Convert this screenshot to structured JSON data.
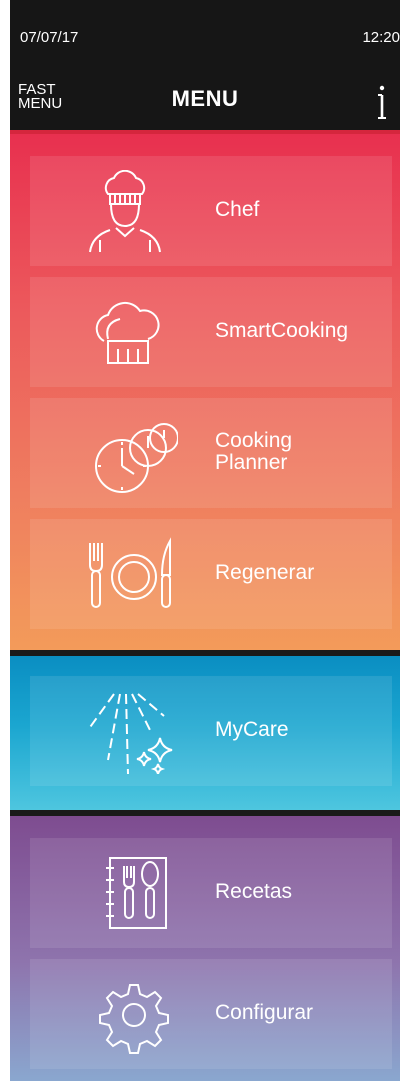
{
  "status": {
    "date": "07/07/17",
    "time": "12:20"
  },
  "nav": {
    "fast_menu": "FAST MENU",
    "title": "MENU"
  },
  "menu": {
    "chef": "Chef",
    "smartcooking": "SmartCooking",
    "cooking_planner": "Cooking Planner",
    "regenerar": "Regenerar",
    "mycare": "MyCare",
    "recetas": "Recetas",
    "configurar": "Configurar"
  },
  "icons": {
    "info": "info-icon",
    "chef": "chef-icon",
    "smartcooking": "chef-hat-icon",
    "cooking_planner": "clocks-icon",
    "regenerar": "cutlery-plate-icon",
    "mycare": "sparkle-spray-icon",
    "recetas": "recipe-book-icon",
    "configurar": "gear-icon"
  },
  "colors": {
    "header_bg": "#161616",
    "warm_top": "#e8304f",
    "warm_bottom": "#f39b5a",
    "blue_top": "#0a8ec2",
    "blue_bottom": "#4ec6df",
    "purple_top": "#7e4c90",
    "purple_bottom": "#8aa7cf"
  }
}
